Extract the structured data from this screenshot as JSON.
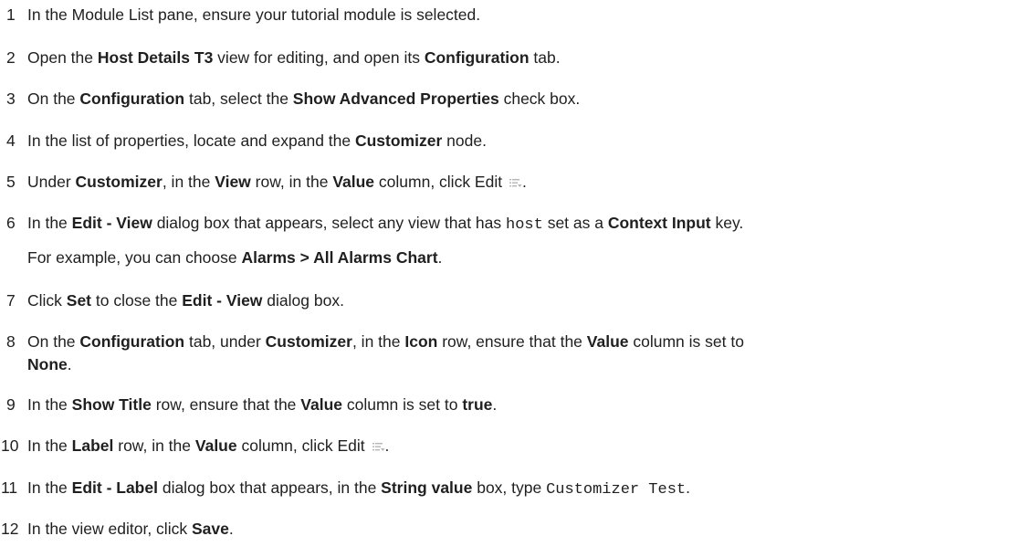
{
  "steps": [
    {
      "num": "1",
      "parts": [
        "In the Module List pane, ensure your tutorial module is selected."
      ]
    },
    {
      "num": "2",
      "parts": [
        "Open the ",
        "Host Details T3",
        " view for editing, and open its ",
        "Configuration",
        " tab."
      ]
    },
    {
      "num": "3",
      "parts": [
        "On the ",
        "Configuration",
        " tab, select the ",
        "Show Advanced Properties",
        " check box."
      ]
    },
    {
      "num": "4",
      "parts": [
        "In the list of properties, locate and expand the ",
        "Customizer",
        " node."
      ]
    },
    {
      "num": "5",
      "parts": [
        "Under ",
        "Customizer",
        ", in the ",
        "View",
        " row, in the ",
        "Value",
        " column, click Edit",
        "."
      ]
    },
    {
      "num": "6",
      "parts": [
        "In the ",
        "Edit - View",
        " dialog box that appears, select any view that has ",
        "host",
        " set as a ",
        "Context Input",
        " key."
      ],
      "note_parts": [
        "For example, you can choose ",
        "Alarms > All Alarms Chart",
        "."
      ]
    },
    {
      "num": "7",
      "parts": [
        "Click ",
        "Set",
        " to close the ",
        "Edit - View",
        " dialog box."
      ]
    },
    {
      "num": "8",
      "parts": [
        "On the ",
        "Configuration",
        " tab, under ",
        "Customizer",
        ", in the ",
        "Icon",
        " row, ensure that the ",
        "Value",
        " column is set to"
      ],
      "cont_parts": [
        "None",
        "."
      ]
    },
    {
      "num": "9",
      "parts": [
        "In the ",
        "Show Title",
        " row, ensure that the ",
        "Value",
        " column is set to ",
        "true",
        "."
      ]
    },
    {
      "num": "10",
      "parts": [
        "In the ",
        "Label",
        " row, in the ",
        "Value",
        " column, click Edit",
        "."
      ]
    },
    {
      "num": "11",
      "parts": [
        "In the ",
        "Edit - Label",
        " dialog box that appears, in the ",
        "String value",
        " box, type ",
        "Customizer Test",
        "."
      ]
    },
    {
      "num": "12",
      "parts": [
        "In the view editor, click ",
        "Save",
        "."
      ]
    }
  ],
  "icons": {
    "edit": "edit-list-icon"
  }
}
